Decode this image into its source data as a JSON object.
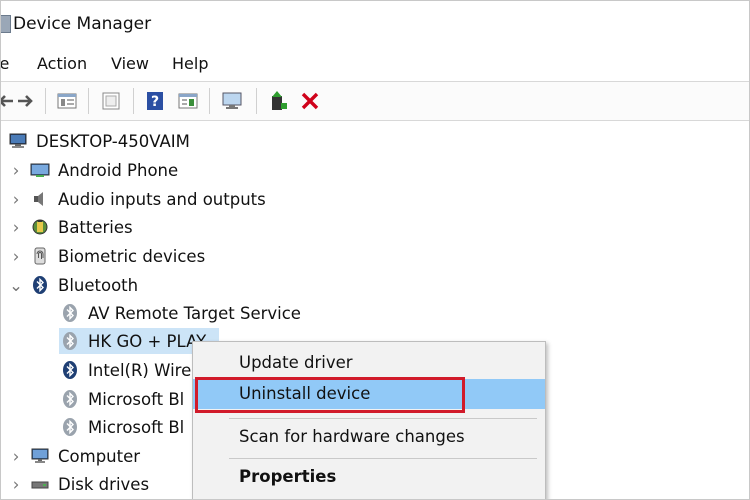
{
  "window": {
    "title": "Device Manager"
  },
  "menu": [
    "le",
    "Action",
    "View",
    "Help"
  ],
  "toolbar_icons": [
    "back-arrow-icon",
    "forward-arrow-icon",
    "properties-icon",
    "window-icon",
    "help-icon",
    "driver-icon",
    "monitor-icon",
    "enable-device-icon",
    "uninstall-icon"
  ],
  "tree": {
    "root": "DESKTOP-450VAIM",
    "categories": [
      "Android Phone",
      "Audio inputs and outputs",
      "Batteries",
      "Biometric devices",
      "Bluetooth"
    ],
    "bluetooth_children": [
      "AV Remote Target Service",
      "HK GO + PLAY",
      "Intel(R) Wire",
      "Microsoft Bl",
      "Microsoft Bl"
    ],
    "categories_after": [
      "Computer",
      "Disk drives"
    ]
  },
  "context_menu": {
    "items": [
      "Update driver",
      "Uninstall device",
      "Scan for hardware changes",
      "Properties"
    ],
    "highlighted": "Uninstall device"
  },
  "colors": {
    "selection": "#cce4f7",
    "menu_highlight": "#91c9f7",
    "red_box": "#d11a2a",
    "bluetooth": "#1f3f74"
  }
}
